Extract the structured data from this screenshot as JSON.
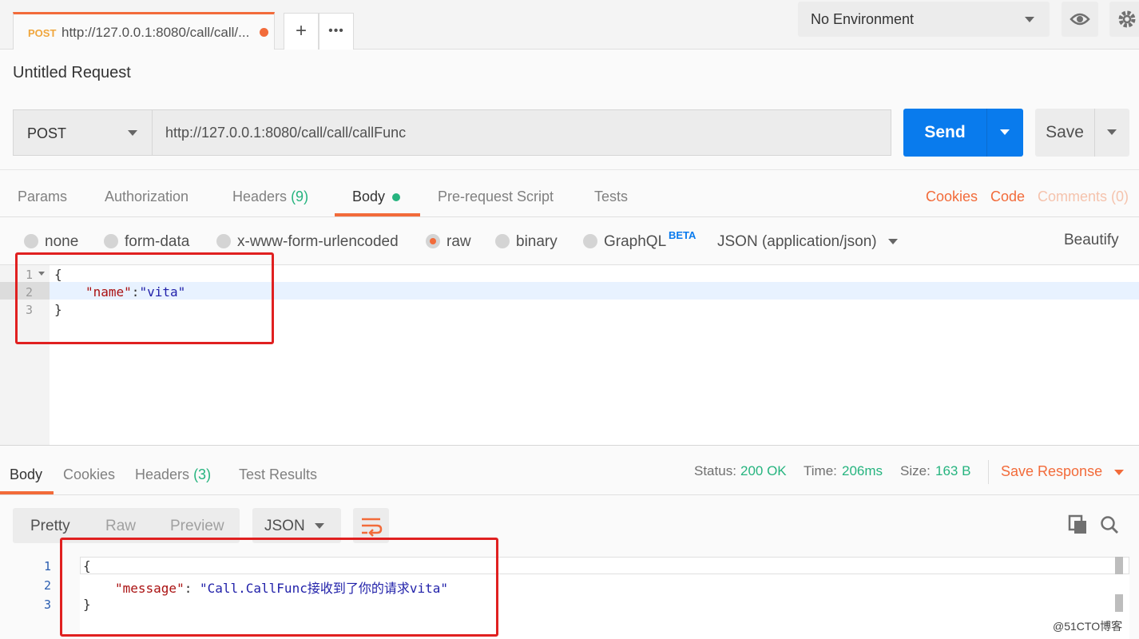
{
  "tab": {
    "method": "POST",
    "url": "http://127.0.0.1:8080/call/call/...",
    "new_tab_label": "+",
    "more_label": "•••"
  },
  "environment": {
    "selected": "No Environment"
  },
  "request": {
    "title": "Untitled Request",
    "method": "POST",
    "url": "http://127.0.0.1:8080/call/call/callFunc",
    "send_label": "Send",
    "save_label": "Save"
  },
  "request_tabs": {
    "params": "Params",
    "authorization": "Authorization",
    "headers": "Headers",
    "headers_count": "(9)",
    "body": "Body",
    "pre_request": "Pre-request Script",
    "tests": "Tests",
    "cookies": "Cookies",
    "code": "Code",
    "comments": "Comments (0)"
  },
  "body_types": {
    "none": "none",
    "form_data": "form-data",
    "urlencoded": "x-www-form-urlencoded",
    "raw": "raw",
    "binary": "binary",
    "graphql": "GraphQL",
    "beta": "BETA",
    "content_type": "JSON (application/json)",
    "beautify": "Beautify",
    "selected": "raw"
  },
  "request_body": {
    "line_numbers": [
      "1",
      "2",
      "3"
    ],
    "open": "{",
    "key": "\"name\"",
    "colon": ":",
    "value": "\"vita\"",
    "close": "}"
  },
  "response_tabs": {
    "body": "Body",
    "cookies": "Cookies",
    "headers": "Headers",
    "headers_count": "(3)",
    "test_results": "Test Results"
  },
  "response_status": {
    "status_label": "Status:",
    "status_value": "200 OK",
    "time_label": "Time:",
    "time_value": "206ms",
    "size_label": "Size:",
    "size_value": "163 B",
    "save_response": "Save Response"
  },
  "response_view": {
    "pretty": "Pretty",
    "raw": "Raw",
    "preview": "Preview",
    "format": "JSON"
  },
  "response_body": {
    "line_numbers": [
      "1",
      "2",
      "3"
    ],
    "open": "{",
    "key": "\"message\"",
    "colon": ": ",
    "value": "\"Call.CallFunc接收到了你的请求vita\"",
    "close": "}"
  },
  "watermark": "@51CTO博客",
  "colors": {
    "accent": "#f26b3a",
    "primary": "#097bed",
    "success": "#26b47f",
    "highlight": "#e02020"
  }
}
